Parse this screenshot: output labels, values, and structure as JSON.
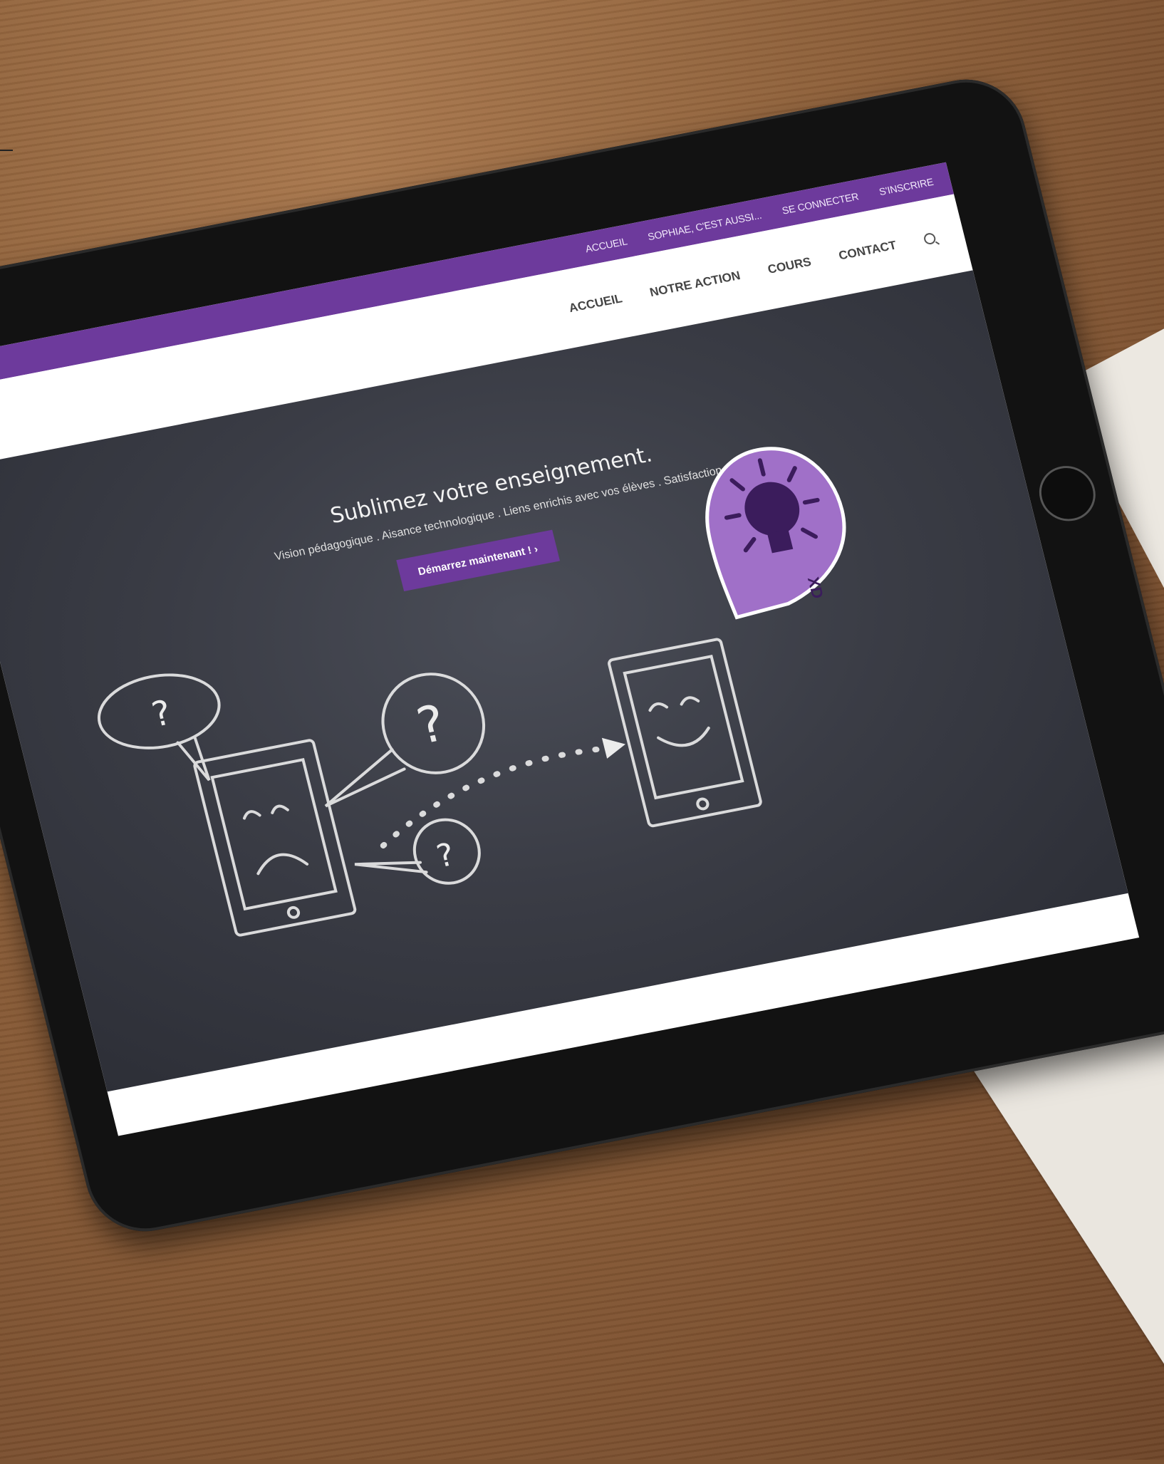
{
  "topbar": {
    "links": [
      "ACCUEIL",
      "SOPHIAE, C'EST AUSSI...",
      "SE CONNECTER",
      "S'INSCRIRE"
    ]
  },
  "nav": {
    "items": [
      "ACCUEIL",
      "NOTRE ACTION",
      "COURS",
      "CONTACT"
    ],
    "search_icon": "search-icon"
  },
  "hero": {
    "title": "Sublimez votre enseignement.",
    "subtitle": "Vision pédagogique . Aisance technologique . Liens enrichis avec vos élèves . Satisfaction",
    "cta_label": "Démarrez maintenant ! ›",
    "badge_text": "XD"
  },
  "colors": {
    "brand_purple": "#6d3a9c",
    "chalkboard": "#3a3c45",
    "badge_purple": "#a070c8"
  }
}
